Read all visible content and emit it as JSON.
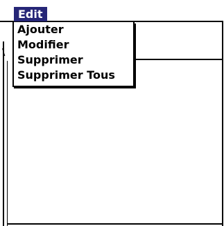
{
  "menubar": {
    "active_menu": "Edit",
    "active_color": "#262677"
  },
  "dropdown": {
    "items": [
      {
        "label": "Ajouter"
      },
      {
        "label": "Modifier"
      },
      {
        "label": "Supprimer"
      },
      {
        "label": "Supprimer Tous"
      }
    ]
  },
  "window": {
    "notch_glyph": "\\"
  }
}
